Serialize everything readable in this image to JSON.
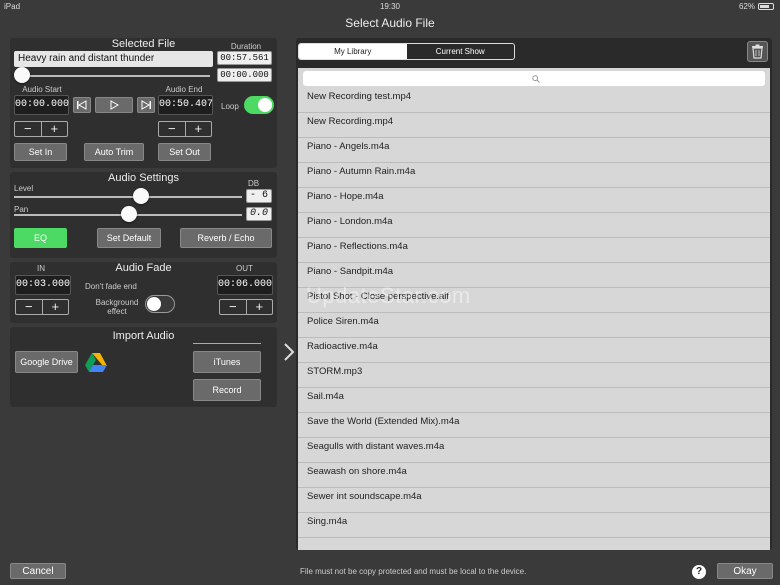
{
  "status": {
    "device": "iPad",
    "time": "19:30",
    "battery": "62%"
  },
  "title": "Select Audio File",
  "selected_file": {
    "heading": "Selected File",
    "name": "Heavy rain and distant thunder",
    "duration_label": "Duration",
    "duration": "00:57.561",
    "position": "00:00.000",
    "audio_start_label": "Audio Start",
    "audio_start": "00:00.000",
    "audio_end_label": "Audio End",
    "audio_end": "00:50.407",
    "loop_label": "Loop",
    "set_in": "Set In",
    "auto_trim": "Auto Trim",
    "set_out": "Set Out"
  },
  "audio_settings": {
    "heading": "Audio Settings",
    "db_label": "DB",
    "level_label": "Level",
    "level_value": "- 6",
    "pan_label": "Pan",
    "pan_value": "0.0",
    "eq": "EQ",
    "set_default": "Set Default",
    "reverb": "Reverb / Echo"
  },
  "audio_fade": {
    "heading": "Audio Fade",
    "in_label": "IN",
    "in_value": "00:03.000",
    "out_label": "OUT",
    "out_value": "00:06.000",
    "dont_fade_end": "Don't fade end",
    "background_effect_1": "Background",
    "background_effect_2": "effect"
  },
  "import_audio": {
    "heading": "Import Audio",
    "google_drive": "Google Drive",
    "itunes": "iTunes",
    "record": "Record"
  },
  "library": {
    "tabs": [
      "My Library",
      "Current Show"
    ],
    "items": [
      "New Recording test.mp4",
      "New Recording.mp4",
      "Piano - Angels.m4a",
      "Piano - Autumn Rain.m4a",
      "Piano - Hope.m4a",
      "Piano - London.m4a",
      "Piano - Reflections.m4a",
      "Piano - Sandpit.m4a",
      "Pistol Shot - Close perspective.aif",
      "Police Siren.m4a",
      "Radioactive.m4a",
      "STORM.mp3",
      "Sail.m4a",
      "Save the World (Extended Mix).m4a",
      "Seagulls with distant waves.m4a",
      "Seawash on shore.m4a",
      "Sewer int soundscape.m4a",
      "Sing.m4a"
    ]
  },
  "watermark": "UpdateStar.com",
  "footer": {
    "cancel": "Cancel",
    "note": "File must not be copy protected and must be local to the device.",
    "help": "?",
    "okay": "Okay"
  }
}
